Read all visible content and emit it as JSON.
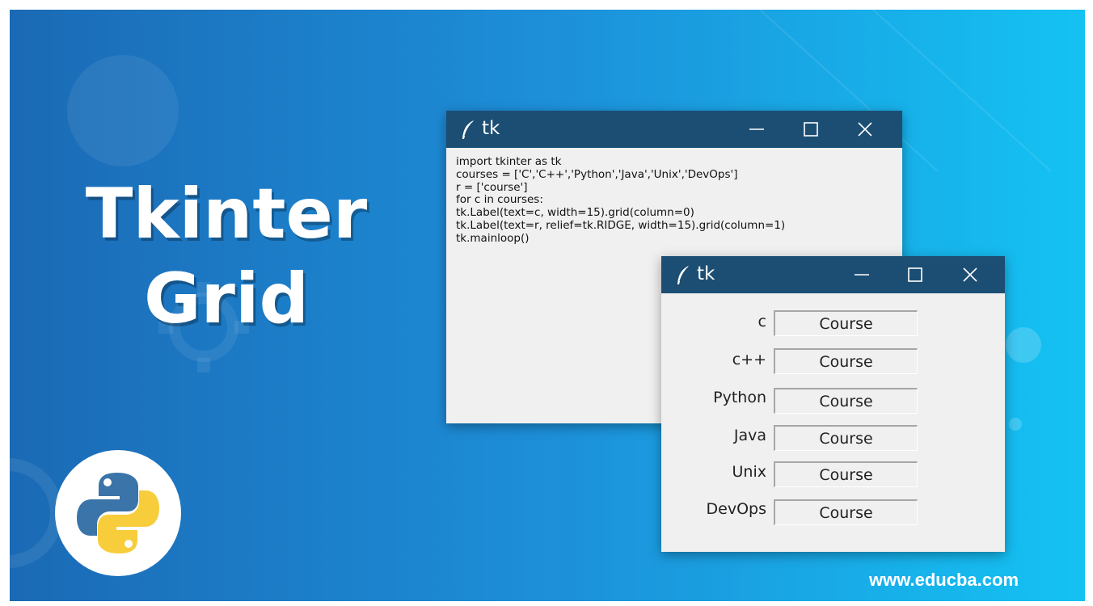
{
  "banner": {
    "title_line1": "Tkinter",
    "title_line2": "Grid",
    "website": "www.educba.com",
    "logo_icon": "python-logo-icon"
  },
  "code_window": {
    "title": "tk",
    "icon": "feather-icon",
    "controls": [
      "minimize-icon",
      "maximize-icon",
      "close-icon"
    ],
    "code_lines": [
      "import tkinter as tk",
      "courses = ['C','C++','Python','Java','Unix','DevOps']",
      "r = ['course']",
      "for c in courses:",
      "tk.Label(text=c, width=15).grid(column=0)",
      "tk.Label(text=r, relief=tk.RIDGE, width=15).grid(column=1)",
      "tk.mainloop()"
    ]
  },
  "grid_window": {
    "title": "tk",
    "icon": "feather-icon",
    "controls": [
      "minimize-icon",
      "maximize-icon",
      "close-icon"
    ],
    "rows": [
      {
        "label": "c",
        "value": "Course"
      },
      {
        "label": "c++",
        "value": "Course"
      },
      {
        "label": "Python",
        "value": "Course"
      },
      {
        "label": "Java",
        "value": "Course"
      },
      {
        "label": "Unix",
        "value": "Course"
      },
      {
        "label": "DevOps",
        "value": "Course"
      }
    ]
  },
  "colors": {
    "titlebar": "#1c4e74",
    "window_bg": "#f0f0f0",
    "python_blue": "#3a74a8",
    "python_yellow": "#f7cd3c"
  }
}
